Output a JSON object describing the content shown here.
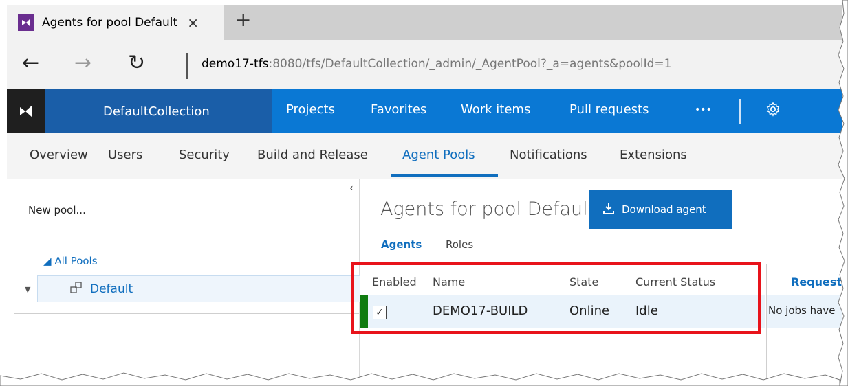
{
  "browser": {
    "tab_title": "Agents for pool Default",
    "tab_close": "×",
    "new_tab": "+",
    "url_host": "demo17-tfs",
    "url_rest": ":8080/tfs/DefaultCollection/_admin/_AgentPool?_a=agents&poolId=1",
    "back_glyph": "←",
    "forward_glyph": "→",
    "refresh_glyph": "↻"
  },
  "topnav": {
    "collection": "DefaultCollection",
    "items": [
      "Projects",
      "Favorites",
      "Work items",
      "Pull requests",
      "•••"
    ],
    "settings_icon": "gear-icon"
  },
  "subnav": {
    "items": [
      "Overview",
      "Users",
      "Security",
      "Build and Release",
      "Agent Pools",
      "Notifications",
      "Extensions"
    ],
    "active": "Agent Pools"
  },
  "leftpanel": {
    "collapse": "‹",
    "new_pool": "New pool...",
    "all_pools": "All Pools",
    "pool_name": "Default"
  },
  "main": {
    "title": "Agents for pool Default",
    "download_button": "Download agent",
    "pivots": [
      "Agents",
      "Roles"
    ],
    "columns": [
      "Enabled",
      "Name",
      "State",
      "Current Status"
    ],
    "requests_header": "Request",
    "agents": [
      {
        "enabled": true,
        "name": "DEMO17-BUILD",
        "state": "Online",
        "status": "Idle"
      }
    ],
    "requests_text": "No jobs have"
  },
  "colors": {
    "brand_blue": "#0a78d4",
    "collection_blue": "#1a5ea8",
    "link_blue": "#106ebe",
    "online_green": "#107c10",
    "highlight_red": "#e8131b",
    "vs_purple": "#6a2e8f"
  }
}
